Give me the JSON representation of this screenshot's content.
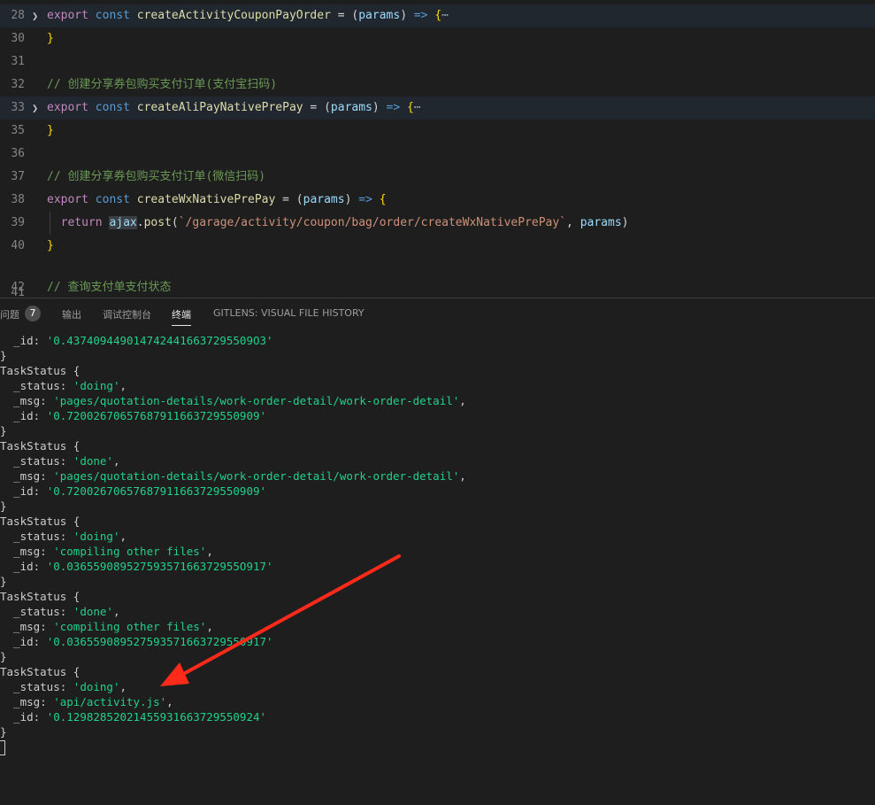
{
  "editor": {
    "lines": [
      {
        "no": "28",
        "folded": true,
        "tokens": [
          {
            "t": "export",
            "c": "ctl"
          },
          {
            "t": " ",
            "c": "txt"
          },
          {
            "t": "const",
            "c": "kw"
          },
          {
            "t": " ",
            "c": "txt"
          },
          {
            "t": "createActivityCouponPayOrder",
            "c": "fn"
          },
          {
            "t": " = (",
            "c": "txt"
          },
          {
            "t": "params",
            "c": "prm"
          },
          {
            "t": ") ",
            "c": "txt"
          },
          {
            "t": "=>",
            "c": "kw"
          },
          {
            "t": " ",
            "c": "txt"
          },
          {
            "t": "{",
            "c": "br"
          },
          {
            "t": "⋯",
            "c": "ell"
          }
        ]
      },
      {
        "no": "30",
        "tokens": [
          {
            "t": "}",
            "c": "br"
          }
        ]
      },
      {
        "no": "31",
        "tokens": []
      },
      {
        "no": "32",
        "tokens": [
          {
            "t": "// 创建分享券包购买支付订单(支付宝扫码)",
            "c": "cmt"
          }
        ]
      },
      {
        "no": "33",
        "folded": true,
        "tokens": [
          {
            "t": "export",
            "c": "ctl"
          },
          {
            "t": " ",
            "c": "txt"
          },
          {
            "t": "const",
            "c": "kw"
          },
          {
            "t": " ",
            "c": "txt"
          },
          {
            "t": "createAliPayNativePrePay",
            "c": "fn"
          },
          {
            "t": " = (",
            "c": "txt"
          },
          {
            "t": "params",
            "c": "prm"
          },
          {
            "t": ") ",
            "c": "txt"
          },
          {
            "t": "=>",
            "c": "kw"
          },
          {
            "t": " ",
            "c": "txt"
          },
          {
            "t": "{",
            "c": "br"
          },
          {
            "t": "⋯",
            "c": "ell"
          }
        ]
      },
      {
        "no": "35",
        "tokens": [
          {
            "t": "}",
            "c": "br"
          }
        ]
      },
      {
        "no": "36",
        "tokens": []
      },
      {
        "no": "37",
        "tokens": [
          {
            "t": "// 创建分享券包购买支付订单(微信扫码)",
            "c": "cmt"
          }
        ]
      },
      {
        "no": "38",
        "tokens": [
          {
            "t": "export",
            "c": "ctl"
          },
          {
            "t": " ",
            "c": "txt"
          },
          {
            "t": "const",
            "c": "kw"
          },
          {
            "t": " ",
            "c": "txt"
          },
          {
            "t": "createWxNativePrePay",
            "c": "fn"
          },
          {
            "t": " = (",
            "c": "txt"
          },
          {
            "t": "params",
            "c": "prm"
          },
          {
            "t": ") ",
            "c": "txt"
          },
          {
            "t": "=>",
            "c": "kw"
          },
          {
            "t": " ",
            "c": "txt"
          },
          {
            "t": "{",
            "c": "br"
          }
        ]
      },
      {
        "no": "39",
        "guide": true,
        "tokens": [
          {
            "t": "  ",
            "c": "txt"
          },
          {
            "t": "return",
            "c": "ctl"
          },
          {
            "t": " ",
            "c": "txt"
          },
          {
            "t": "ajax",
            "c": "prm",
            "hl": true
          },
          {
            "t": ".",
            "c": "txt"
          },
          {
            "t": "post",
            "c": "fn"
          },
          {
            "t": "(",
            "c": "txt"
          },
          {
            "t": "`/garage/activity/coupon/bag/order/createWxNativePrePay`",
            "c": "str"
          },
          {
            "t": ", ",
            "c": "txt"
          },
          {
            "t": "params",
            "c": "prm"
          },
          {
            "t": ")",
            "c": "txt"
          }
        ]
      },
      {
        "no": "40",
        "tokens": [
          {
            "t": "}",
            "c": "br"
          }
        ]
      },
      {
        "no": "41",
        "tokens": []
      },
      {
        "no": "42",
        "tokens": [
          {
            "t": "// 查询支付单支付状态",
            "c": "cmt"
          }
        ]
      }
    ]
  },
  "panel": {
    "tabs": [
      {
        "label": "问题",
        "badge": "7",
        "name": "tab-problems",
        "active": false
      },
      {
        "label": "输出",
        "name": "tab-output",
        "active": false
      },
      {
        "label": "调试控制台",
        "name": "tab-debug-console",
        "active": false
      },
      {
        "label": "终端",
        "name": "tab-terminal",
        "active": true
      },
      {
        "label": "GITLENS: VISUAL FILE HISTORY",
        "name": "tab-gitlens-visual-file-history",
        "active": false
      }
    ]
  },
  "terminal": {
    "lines": [
      [
        {
          "t": "  _id: "
        },
        {
          "t": "'0.4374094490147424416637295509O3'",
          "s": true
        }
      ],
      [
        {
          "t": "}"
        }
      ],
      [
        {
          "t": "TaskStatus {"
        }
      ],
      [
        {
          "t": "  _status: "
        },
        {
          "t": "'doing'",
          "s": true
        },
        {
          "t": ","
        }
      ],
      [
        {
          "t": "  _msg: "
        },
        {
          "t": "'pages/quotation-details/work-order-detail/work-order-detail'",
          "s": true
        },
        {
          "t": ","
        }
      ],
      [
        {
          "t": "  _id: "
        },
        {
          "t": "'0.72002670657687911663729550909'",
          "s": true
        }
      ],
      [
        {
          "t": "}"
        }
      ],
      [
        {
          "t": "TaskStatus {"
        }
      ],
      [
        {
          "t": "  _status: "
        },
        {
          "t": "'done'",
          "s": true
        },
        {
          "t": ","
        }
      ],
      [
        {
          "t": "  _msg: "
        },
        {
          "t": "'pages/quotation-details/work-order-detail/work-order-detail'",
          "s": true
        },
        {
          "t": ","
        }
      ],
      [
        {
          "t": "  _id: "
        },
        {
          "t": "'0.72002670657687911663729550909'",
          "s": true
        }
      ],
      [
        {
          "t": "}"
        }
      ],
      [
        {
          "t": "TaskStatus {"
        }
      ],
      [
        {
          "t": "  _status: "
        },
        {
          "t": "'doing'",
          "s": true
        },
        {
          "t": ","
        }
      ],
      [
        {
          "t": "  _msg: "
        },
        {
          "t": "'compiling other files'",
          "s": true
        },
        {
          "t": ","
        }
      ],
      [
        {
          "t": "  _id: "
        },
        {
          "t": "'0.03655908952759357166372955O917'",
          "s": true
        }
      ],
      [
        {
          "t": "}"
        }
      ],
      [
        {
          "t": "TaskStatus {"
        }
      ],
      [
        {
          "t": "  _status: "
        },
        {
          "t": "'done'",
          "s": true
        },
        {
          "t": ","
        }
      ],
      [
        {
          "t": "  _msg: "
        },
        {
          "t": "'compiling other files'",
          "s": true
        },
        {
          "t": ","
        }
      ],
      [
        {
          "t": "  _id: "
        },
        {
          "t": "'0.036559089527593571663729550917'",
          "s": true
        }
      ],
      [
        {
          "t": "}"
        }
      ],
      [
        {
          "t": "TaskStatus {"
        }
      ],
      [
        {
          "t": "  _status: "
        },
        {
          "t": "'doing'",
          "s": true
        },
        {
          "t": ","
        }
      ],
      [
        {
          "t": "  _msg: "
        },
        {
          "t": "'api/activity.js'",
          "s": true
        },
        {
          "t": ","
        }
      ],
      [
        {
          "t": "  _id: "
        },
        {
          "t": "'0.12982852021455931663729550924'",
          "s": true
        }
      ],
      [
        {
          "t": "}"
        }
      ]
    ]
  },
  "colors": {
    "background": "#1e1e1e",
    "terminal_string": "#23d18b",
    "annotation_arrow": "#ff2a1a"
  }
}
